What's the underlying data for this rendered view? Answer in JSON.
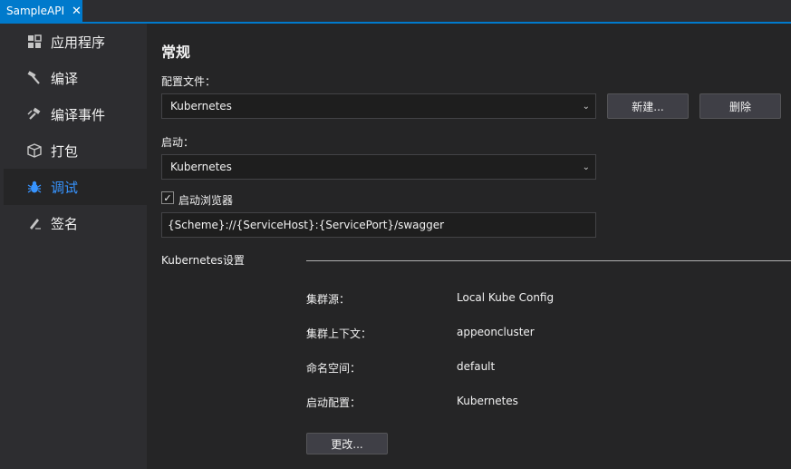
{
  "tab": {
    "title": "SampleAPI",
    "close_glyph": "✕"
  },
  "sidebar": {
    "items": [
      {
        "label": "应用程序",
        "icon": "application-icon"
      },
      {
        "label": "编译",
        "icon": "hammer-icon"
      },
      {
        "label": "编译事件",
        "icon": "build-events-icon"
      },
      {
        "label": "打包",
        "icon": "package-icon"
      },
      {
        "label": "调试",
        "icon": "bug-icon",
        "active": true
      },
      {
        "label": "签名",
        "icon": "signing-icon"
      }
    ]
  },
  "main": {
    "section_title": "常规",
    "profile_label": "配置文件：",
    "profile_value": "Kubernetes",
    "new_button": "新建...",
    "delete_button": "删除",
    "launch_label": "启动：",
    "launch_value": "Kubernetes",
    "launch_browser_label": "启动浏览器",
    "launch_browser_checked": true,
    "check_glyph": "✓",
    "browser_url": "{Scheme}://{ServiceHost}:{ServicePort}/swagger",
    "dropdown_glyph": "⌄",
    "k8s_section_label": "Kubernetes设置",
    "k8s": {
      "cluster_source_label": "集群源：",
      "cluster_source_value": "Local Kube Config",
      "cluster_context_label": "集群上下文：",
      "cluster_context_value": "appeoncluster",
      "namespace_label": "命名空间：",
      "namespace_value": "default",
      "launch_config_label": "启动配置：",
      "launch_config_value": "Kubernetes",
      "change_button": "更改..."
    }
  },
  "colors": {
    "accent": "#007acc",
    "active_text": "#3794ff",
    "background": "#252526",
    "sidebar": "#2d2d30"
  }
}
